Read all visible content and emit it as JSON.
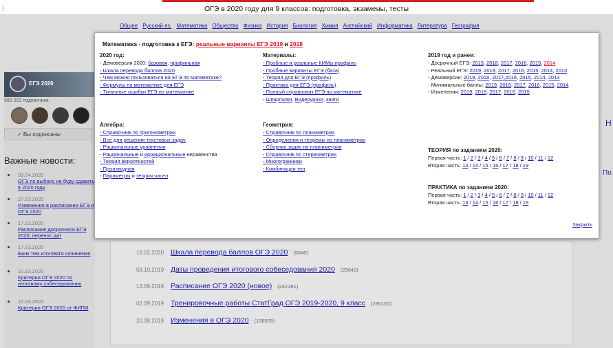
{
  "topbar": {
    "logo_fragment": ")",
    "title": "ОГЭ в 2020 году для 9 классов: подготовка, экзамены, тесты"
  },
  "subjects": [
    "Общее",
    "Русский яз.",
    "Математика",
    "Обществo",
    "Физика",
    "История",
    "Биология",
    "Химия",
    "Английский",
    "Информатика",
    "Литература",
    "География"
  ],
  "left": {
    "banner_text": "ЕГЭ 2020",
    "subscribers": "560 253 подписчика",
    "subscribed_btn": "✓  Вы подписаны",
    "news_title": "Важные новости:",
    "news": [
      {
        "date": "09.04.2020",
        "text": "ОГЭ по выбору не буду сдавать в 2020 году"
      },
      {
        "date": "27.03.2020",
        "text": "Изменения в расписании ЕГЭ и ОГЭ 2020"
      },
      {
        "date": "17.03.2020",
        "text": "Расписание досрочного ЕГЭ 2020, перенос дат"
      },
      {
        "date": "17.03.2020",
        "text": "Банк тем итогового сочинения"
      },
      {
        "date": "10.03.2020",
        "text": "Критерии ОГЭ 2020 по итоговому собеседованию"
      },
      {
        "date": "10.03.2020",
        "text": "Критерии ОГЭ 2020 от ФИПИ"
      }
    ]
  },
  "main_rows": [
    {
      "date": "19.02.2020",
      "title": "Шкала перевода баллов ОГЭ 2020",
      "count": "(5040)"
    },
    {
      "date": "08.10.2019",
      "title": "Даты проведения итогового собеседования 2020",
      "count": "(25043)"
    },
    {
      "date": "13.09.2019",
      "title": "Расписание ОГЭ 2020 (новое)",
      "count": "(242181)"
    },
    {
      "date": "02.09.2019",
      "title": "Тренировочные работы СтатГрад ОГЭ 2019-2020, 9 класс",
      "count": "(280150)"
    },
    {
      "date": "20.08.2019",
      "title": "Изменения в ОГЭ 2020",
      "count": "(106509)"
    }
  ],
  "edge": {
    "right1": "Н",
    "right2": "По"
  },
  "popup": {
    "title_prefix": "Математика - подготовка к ЕГЭ: ",
    "title_link1": "реальные варианты ЕГЭ 2019",
    "title_and": " и ",
    "title_link2": "2018",
    "col1": {
      "heading": "2020 год:",
      "demo_prefix": "- Демоверсия 2020: ",
      "demo_link1": "базовая",
      "demo_comma": ", ",
      "demo_link2": "профильная",
      "items": [
        "- Шкала перевода баллов 2020",
        "- Чем можно пользоваться на ЕГЭ по математике?",
        "- Формулы по математике для ЕГЭ",
        "- Типичные ошибки ЕГЭ по математике"
      ]
    },
    "col1b": {
      "heading": "Алгебра:",
      "items": [
        "- Справочник по тригонометрии",
        "- Все для решения текстовых задач",
        "- Рациональные уравнения"
      ],
      "ineq_prefix": "- ",
      "ineq_link1": "Рациональные",
      "ineq_and": " и ",
      "ineq_link2": "иррациональные",
      "ineq_suffix": " неравенства",
      "items2": [
        "- Теория вероятностей",
        "- Производная"
      ],
      "param_prefix": "- ",
      "param_link1": "Параметры",
      "param_and": " и ",
      "param_link2": "теория чисел"
    },
    "col2": {
      "heading": "Материалы:",
      "items": [
        "- Пробные и реальные КИМы профиль",
        "- Пробные варианты ЕГЭ (база)",
        "- Теория для ЕГЭ (профиль)",
        "- Практика для ЕГЭ (профиль)",
        "- Полный справочник ЕГЭ по математике"
      ],
      "last_prefix": "- ",
      "last_link1": "Шпаргалки",
      "last_comma1": ", ",
      "last_link2": "Видеоуроки",
      "last_comma2": ", ",
      "last_link3": "книги"
    },
    "col2b": {
      "heading": "Геометрия:",
      "items": [
        "- Справочник по планиметрии",
        "- Определения и теоремы по планиметрии",
        "- Сборник задач по планиметрии",
        "- Справочник по стереометрии",
        "- Многогранники",
        "- Комбинации тел"
      ]
    },
    "col3": {
      "heading": "2019 год и ранее:",
      "rows": [
        {
          "label": "- Досрочный ЕГЭ: ",
          "years": [
            "2019",
            "2018",
            "2017",
            "2016",
            "2015",
            "2014"
          ]
        },
        {
          "label": "- Реальный ЕГЭ: ",
          "years": [
            "2019",
            "2018",
            "2017",
            "2016",
            "2015",
            "2014",
            "2013"
          ]
        },
        {
          "label": "- Демоверсии: ",
          "years": [
            "2019",
            "2018",
            "2017,2016",
            "2015",
            "2014",
            "2013"
          ]
        },
        {
          "label": "- Минимальные баллы: ",
          "years": [
            "2019",
            "2018",
            "2017",
            "2016",
            "2015",
            "2014"
          ]
        },
        {
          "label": "- Изменения: ",
          "years": [
            "2019",
            "2018",
            "2017",
            "2016",
            "2015"
          ]
        }
      ],
      "theory_heading": "ТЕОРИЯ по заданиям 2020:",
      "practice_heading": "ПРАКТИКА по заданиям 2020:",
      "part1_label": "Первая часть: ",
      "part2_label": "Вторая часть: ",
      "part1": [
        "1",
        "2",
        "3",
        "4",
        "5",
        "6",
        "7",
        "8",
        "9",
        "10",
        "11",
        "12"
      ],
      "part2": [
        "13",
        "14",
        "15",
        "16",
        "17",
        "18",
        "19"
      ]
    },
    "close": "Закрыть"
  },
  "colors": {
    "link": "#1a1aa6",
    "accent_red": "#e0141e",
    "topline": "#d32020"
  }
}
